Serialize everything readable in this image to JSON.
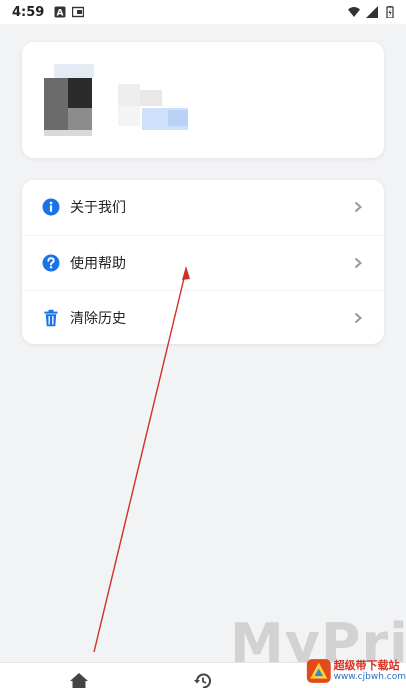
{
  "status_bar": {
    "time": "4:59"
  },
  "menu": {
    "items": [
      {
        "label": "关于我们",
        "icon": "info-icon"
      },
      {
        "label": "使用帮助",
        "icon": "help-icon"
      },
      {
        "label": "清除历史",
        "icon": "trash-icon"
      }
    ]
  },
  "watermark": {
    "text": "MyPrice",
    "sub": "myprice"
  },
  "site_badge": {
    "title": "超级带下载站",
    "url": "www.cjbwh.com"
  },
  "colors": {
    "accent": "#1a73e8",
    "arrow": "#d0302a",
    "background": "#f2f3f5"
  }
}
